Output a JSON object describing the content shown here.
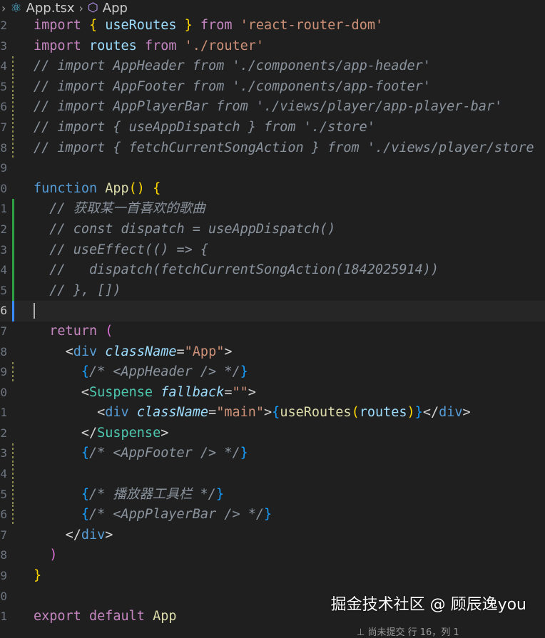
{
  "breadcrumb": {
    "lead_chevron": "›",
    "file": "App.tsx",
    "separator": "›",
    "symbol": "App"
  },
  "icons": {
    "file_icon": "react-icon",
    "symbol_icon": "cube-icon"
  },
  "lines": [
    {
      "n": "2",
      "tokens": [
        [
          "kw2",
          "import"
        ],
        [
          "punc",
          " "
        ],
        [
          "brace",
          "{"
        ],
        [
          "punc",
          " "
        ],
        [
          "var",
          "useRoutes"
        ],
        [
          "punc",
          " "
        ],
        [
          "brace",
          "}"
        ],
        [
          "punc",
          " "
        ],
        [
          "kw2",
          "from"
        ],
        [
          "punc",
          " "
        ],
        [
          "str",
          "'react-router-dom'"
        ]
      ]
    },
    {
      "n": "3",
      "tokens": [
        [
          "kw2",
          "import"
        ],
        [
          "punc",
          " "
        ],
        [
          "var",
          "routes"
        ],
        [
          "punc",
          " "
        ],
        [
          "kw2",
          "from"
        ],
        [
          "punc",
          " "
        ],
        [
          "str",
          "'./router'"
        ]
      ]
    },
    {
      "n": "4",
      "tokens": [
        [
          "cmgray",
          "// import AppHeader from './components/app-header'"
        ]
      ]
    },
    {
      "n": "5",
      "tokens": [
        [
          "cmgray",
          "// import AppFooter from './components/app-footer'"
        ]
      ]
    },
    {
      "n": "6",
      "tokens": [
        [
          "cmgray",
          "// import AppPlayerBar from './views/player/app-player-bar'"
        ]
      ]
    },
    {
      "n": "7",
      "tokens": [
        [
          "cmgray",
          "// import { useAppDispatch } from './store'"
        ]
      ]
    },
    {
      "n": "8",
      "tokens": [
        [
          "cmgray",
          "// import { fetchCurrentSongAction } from './views/player/store"
        ]
      ]
    },
    {
      "n": "9",
      "tokens": []
    },
    {
      "n": "0",
      "tokens": [
        [
          "kw",
          "function"
        ],
        [
          "punc",
          " "
        ],
        [
          "fn",
          "App"
        ],
        [
          "brace",
          "()"
        ],
        [
          "punc",
          " "
        ],
        [
          "brace",
          "{"
        ]
      ]
    },
    {
      "n": "1",
      "tokens": [
        [
          "punc",
          "  "
        ],
        [
          "cmgray",
          "// 获取某一首喜欢的歌曲"
        ]
      ]
    },
    {
      "n": "2",
      "tokens": [
        [
          "punc",
          "  "
        ],
        [
          "cmgray",
          "// const dispatch = useAppDispatch()"
        ]
      ]
    },
    {
      "n": "3",
      "tokens": [
        [
          "punc",
          "  "
        ],
        [
          "cmgray",
          "// useEffect(() => {"
        ]
      ]
    },
    {
      "n": "4",
      "tokens": [
        [
          "punc",
          "  "
        ],
        [
          "cmgray",
          "//   dispatch(fetchCurrentSongAction(1842025914))"
        ]
      ]
    },
    {
      "n": "5",
      "tokens": [
        [
          "punc",
          "  "
        ],
        [
          "cmgray",
          "// }, [])"
        ]
      ]
    },
    {
      "n": "6",
      "tokens": []
    },
    {
      "n": "7",
      "tokens": [
        [
          "punc",
          "  "
        ],
        [
          "kw2",
          "return"
        ],
        [
          "punc",
          " "
        ],
        [
          "brace2",
          "("
        ]
      ]
    },
    {
      "n": "8",
      "tokens": [
        [
          "punc",
          "    "
        ],
        [
          "punc",
          "<"
        ],
        [
          "tag",
          "div"
        ],
        [
          "punc",
          " "
        ],
        [
          "attr",
          "className"
        ],
        [
          "punc",
          "="
        ],
        [
          "str",
          "\"App\""
        ],
        [
          "punc",
          ">"
        ]
      ]
    },
    {
      "n": "9",
      "tokens": [
        [
          "punc",
          "      "
        ],
        [
          "brace3",
          "{"
        ],
        [
          "cmgray",
          "/* <AppHeader /> */"
        ],
        [
          "brace3",
          "}"
        ]
      ]
    },
    {
      "n": "0",
      "tokens": [
        [
          "punc",
          "      "
        ],
        [
          "punc",
          "<"
        ],
        [
          "comp",
          "Suspense"
        ],
        [
          "punc",
          " "
        ],
        [
          "attr",
          "fallback"
        ],
        [
          "punc",
          "="
        ],
        [
          "str",
          "\"\""
        ],
        [
          "punc",
          ">"
        ]
      ]
    },
    {
      "n": "1",
      "tokens": [
        [
          "punc",
          "        "
        ],
        [
          "punc",
          "<"
        ],
        [
          "tag",
          "div"
        ],
        [
          "punc",
          " "
        ],
        [
          "attr",
          "className"
        ],
        [
          "punc",
          "="
        ],
        [
          "str",
          "\"main\""
        ],
        [
          "punc",
          ">"
        ],
        [
          "brace3",
          "{"
        ],
        [
          "fn",
          "useRoutes"
        ],
        [
          "brace",
          "("
        ],
        [
          "var",
          "routes"
        ],
        [
          "brace",
          ")"
        ],
        [
          "brace3",
          "}"
        ],
        [
          "punc",
          "</"
        ],
        [
          "tag",
          "div"
        ],
        [
          "punc",
          ">"
        ]
      ]
    },
    {
      "n": "2",
      "tokens": [
        [
          "punc",
          "      "
        ],
        [
          "punc",
          "</"
        ],
        [
          "comp",
          "Suspense"
        ],
        [
          "punc",
          ">"
        ]
      ]
    },
    {
      "n": "3",
      "tokens": [
        [
          "punc",
          "      "
        ],
        [
          "brace3",
          "{"
        ],
        [
          "cmgray",
          "/* <AppFooter /> */"
        ],
        [
          "brace3",
          "}"
        ]
      ]
    },
    {
      "n": "4",
      "tokens": []
    },
    {
      "n": "5",
      "tokens": [
        [
          "punc",
          "      "
        ],
        [
          "brace3",
          "{"
        ],
        [
          "cmgray",
          "/* 播放器工具栏 */"
        ],
        [
          "brace3",
          "}"
        ]
      ]
    },
    {
      "n": "6",
      "tokens": [
        [
          "punc",
          "      "
        ],
        [
          "brace3",
          "{"
        ],
        [
          "cmgray",
          "/* <AppPlayerBar /> */"
        ],
        [
          "brace3",
          "}"
        ]
      ]
    },
    {
      "n": "7",
      "tokens": [
        [
          "punc",
          "    "
        ],
        [
          "punc",
          "</"
        ],
        [
          "tag",
          "div"
        ],
        [
          "punc",
          ">"
        ]
      ]
    },
    {
      "n": "8",
      "tokens": [
        [
          "punc",
          "  "
        ],
        [
          "brace2",
          ")"
        ]
      ]
    },
    {
      "n": "9",
      "tokens": [
        [
          "brace",
          "}"
        ]
      ]
    },
    {
      "n": "0",
      "tokens": []
    },
    {
      "n": "1",
      "tokens": [
        [
          "kw2",
          "export"
        ],
        [
          "punc",
          " "
        ],
        [
          "kw2",
          "default"
        ],
        [
          "punc",
          " "
        ],
        [
          "fn",
          "App"
        ]
      ]
    }
  ],
  "watermark": "掘金技术社区 @ 顾辰逸you",
  "status": "⊥ 尚未提交  行 16，列 1"
}
